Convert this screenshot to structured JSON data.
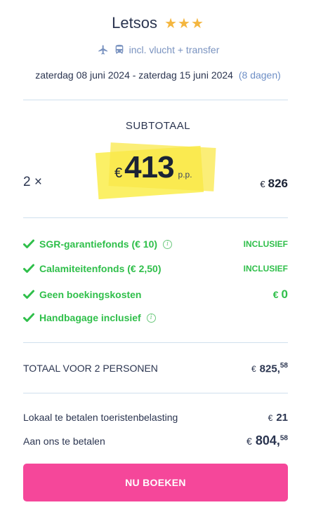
{
  "hotel": {
    "name": "Letsos",
    "stars": "★★★"
  },
  "travel": {
    "includes": "incl. vlucht + transfer"
  },
  "dates": {
    "range": "zaterdag 08 juni 2024 - zaterdag 15 juni 2024",
    "duration": "(8 dagen)"
  },
  "subtotal": {
    "label": "SUBTOTAAL",
    "quantity": "2 ×",
    "currency": "€",
    "price_per_person": "413",
    "pp_label": "p.p.",
    "total": "826"
  },
  "features": [
    {
      "label": "SGR-garantiefonds (€ 10)",
      "status": "INCLUSIEF",
      "has_info": true
    },
    {
      "label": "Calamiteitenfonds (€ 2,50)",
      "status": "INCLUSIEF",
      "has_info": false
    },
    {
      "label": "Geen boekingskosten",
      "status_currency": "€",
      "status_value": "0",
      "has_info": false
    },
    {
      "label": "Handbagage inclusief",
      "status": "",
      "has_info": true
    }
  ],
  "totals": {
    "total_label": "TOTAAL VOOR 2 PERSONEN",
    "total_currency": "€",
    "total_whole": "825,",
    "total_decimals": "58",
    "tax_label": "Lokaal te betalen toeristenbelasting",
    "tax_currency": "€",
    "tax_value": "21",
    "pay_label": "Aan ons te betalen",
    "pay_currency": "€",
    "pay_whole": "804,",
    "pay_decimals": "58"
  },
  "actions": {
    "book_label": "NU BOEKEN"
  },
  "colors": {
    "accent_green": "#2fbf4a",
    "button_pink": "#f5479a",
    "star_gold": "#f4b63f",
    "link_blue": "#6e8fc6",
    "highlight_yellow": "#fae84a"
  }
}
